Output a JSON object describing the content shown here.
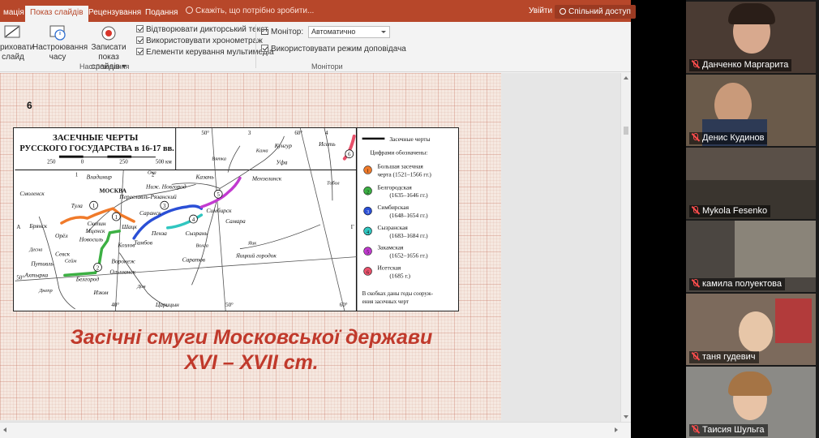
{
  "ribbon_tabs": {
    "animation_cut": "мація",
    "slideshow": "Показ слайдів",
    "review": "Рецензування",
    "view": "Подання",
    "tell_me": "Скажіть, що потрібно зробити...",
    "sign_in": "Увійти",
    "share": "Спільний доступ"
  },
  "ribbon": {
    "hide_slide_1": "риховати",
    "hide_slide_2": "слайд",
    "rehearse_1": "Настроювання",
    "rehearse_2": "часу",
    "record_1": "Записати показ",
    "record_2": "слайдів ▾",
    "play_narrations": "Відтворювати дикторський текст",
    "use_timings": "Використовувати хронометраж",
    "media_controls": "Елементи керування мультимедіа",
    "setup_group": "Настроювання",
    "monitor_label": "Монітор:",
    "monitor_value": "Автоматично",
    "presenter_view": "Використовувати режим доповідача",
    "monitors_group": "Монітори"
  },
  "slide": {
    "number": "6",
    "title_line1": "Засічні смуги Московської держави",
    "title_line2": "XVI – XVII ст."
  },
  "map": {
    "title_1": "ЗАСЕЧНЫЕ ЧЕРТЫ",
    "title_2": "РУССКОГО ГОСУДАРСТВА в 16-17 вв.",
    "scale": [
      "250",
      "0",
      "250",
      "500 км"
    ],
    "legend_line": "Засечные черты",
    "legend_header": "Цифрами обозначены:",
    "legend": [
      {
        "n": "1",
        "color": "#f07a2a",
        "line1": "Большая засечная",
        "line2": "черта   (1521–1566 гг.)"
      },
      {
        "n": "2",
        "color": "#3cb043",
        "line1": "Белгородская",
        "line2": "(1635–1646 гг.)"
      },
      {
        "n": "3",
        "color": "#2a4fd6",
        "line1": "Симбирская",
        "line2": "(1648–1654 гг.)"
      },
      {
        "n": "4",
        "color": "#30c6c0",
        "line1": "Сызранская",
        "line2": "(1683–1684 гг.)"
      },
      {
        "n": "5",
        "color": "#c23ad0",
        "line1": "Закамская",
        "line2": "(1652–1656 гг.)"
      },
      {
        "n": "6",
        "color": "#e8506a",
        "line1": "Исетская",
        "line2": "(1685 г.)"
      }
    ],
    "note_1": "В скобках даны годы сооруж-",
    "note_2": "ения   засечных черт",
    "cities": {
      "vladimir": "Владимир",
      "moskva": "МОСКВА",
      "smolensk": "Смоленск",
      "tula": "Тула",
      "pereslavl": "Переславль-Рязанский",
      "nn": "Ниж. Новгород",
      "kazan": "Казань",
      "saransk": "Саранск",
      "simbirsk": "Симбирск",
      "samara": "Самара",
      "syzran": "Сызрань",
      "penza": "Пенза",
      "tambov": "Тамбов",
      "kozlov": "Козлов",
      "shatsk": "Шацк",
      "skopin": "Скопин",
      "mtsensk": "Мценск",
      "novosil": "Новосиль",
      "orel": "Орёл",
      "bryansk": "Брянск",
      "voronezh": "Воронеж",
      "sevsk": "Севск",
      "putivl": "Путивль",
      "akhtyrka": "Ахтырка",
      "belgorod": "Белгород",
      "olshansk": "Ольшанск",
      "izyum": "Изюм",
      "tsaritsyn": "Царицын",
      "saratov": "Саратов",
      "yaitsky": "Яицкий городок",
      "ufa": "Уфа",
      "kungur": "Кунгур",
      "menzelinsk": "Мензелинск",
      "iset": "Исеть"
    },
    "rivers": {
      "oka": "Ока",
      "volga": "Волга",
      "kama": "Кама",
      "don": "Дон",
      "dnepr": "Днепр",
      "desna": "Десна",
      "seim": "Сейм",
      "yaik": "Яик",
      "tobol": "Тобол",
      "vyatka": "Вятка"
    },
    "grid": {
      "lon30": "30°",
      "lon40": "40°",
      "lon50": "50°",
      "lon60": "60°",
      "lat50": "50°",
      "a": "А",
      "g": "Г",
      "z1": "1",
      "z2": "2",
      "z3": "3",
      "z4": "4"
    }
  },
  "participants": [
    {
      "name": "Данченко Маргарита"
    },
    {
      "name": "Денис Кудинов"
    },
    {
      "name": "Mykola Fesenko"
    },
    {
      "name": "камила полуектова"
    },
    {
      "name": "таня гудевич"
    },
    {
      "name": "Таисия Шульга"
    }
  ]
}
